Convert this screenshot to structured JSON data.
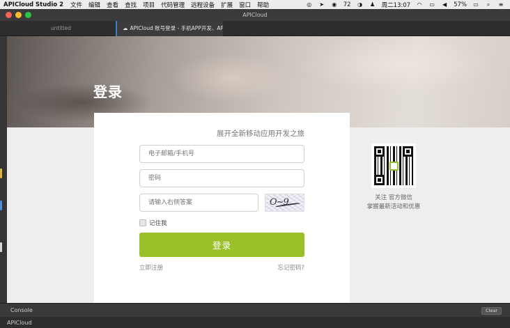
{
  "menubar": {
    "app_name": "APICloud Studio 2",
    "items": [
      "文件",
      "编辑",
      "查看",
      "查找",
      "项目",
      "代码管理",
      "远程设备",
      "扩展",
      "窗口",
      "帮助"
    ],
    "wechat_count": "72",
    "datetime": "周二13:07",
    "battery": "57%"
  },
  "window": {
    "title": "APICloud"
  },
  "tabs": [
    {
      "label": "untitled"
    },
    {
      "label": "APICloud 账号登录 - 手机APP开发、AP"
    }
  ],
  "login": {
    "banner_title": "登录",
    "slogan": "展开全新移动应用开发之旅",
    "email_placeholder": "电子邮箱/手机号",
    "password_placeholder": "密码",
    "captcha_placeholder": "请输入右侧答案",
    "captcha_text": "O~9",
    "remember_label": "记住我",
    "login_button": "登录",
    "register_link": "立即注册",
    "forgot_link": "忘记密码?"
  },
  "qr": {
    "line1": "关注 官方微信",
    "line2": "掌握最新活动和优惠"
  },
  "console": {
    "label": "Console",
    "clear_button": "Clear"
  },
  "statusbar": {
    "text": "APICloud"
  },
  "colors": {
    "accent_green": "#9ac02a",
    "tab_highlight": "#3d7fc7"
  }
}
